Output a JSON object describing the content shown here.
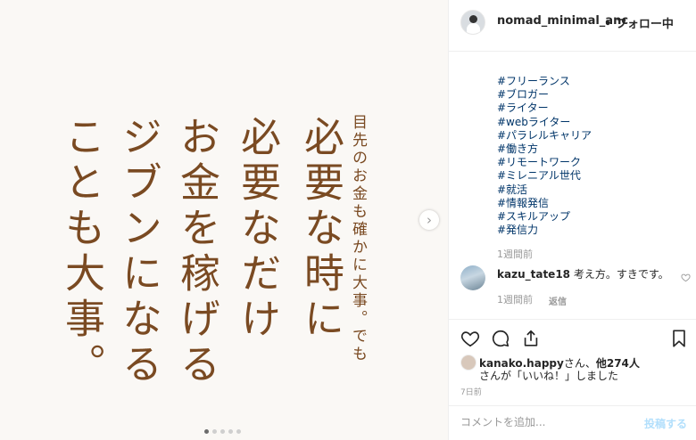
{
  "post": {
    "image_text_columns": [
      "目先のお金も確かに大事。でも",
      "必要な時に",
      "必要なだけ",
      "お金を稼げる",
      "ジブンになる",
      "ことも大事。"
    ]
  },
  "header": {
    "username": "nomad_minimal_anc",
    "follow_label": "• フォロー中"
  },
  "caption": {
    "hashtags": [
      "#フリーランス",
      "#ブロガー",
      "#ライター",
      "#webライター",
      "#パラレルキャリア",
      "#働き方",
      "#リモートワーク",
      "#ミレニアル世代",
      "#就活",
      "#情報発信",
      "#スキルアップ",
      "#発信力"
    ],
    "time": "1週間前"
  },
  "comment": {
    "user": "kazu_tate18",
    "text": " 考え方。すきです。",
    "time": "1週間前",
    "reply_label": "返信"
  },
  "likes": {
    "user": "kanako.happy",
    "line1_suffix": "さん、",
    "others": "他274人",
    "line2": "さんが「いいね！」しました",
    "days_ago": "7日前"
  },
  "comment_box": {
    "placeholder": "コメントを追加...",
    "post_label": "投稿する"
  },
  "colors": {
    "hashtag": "#003569",
    "image_text": "#7a4a22",
    "post_button_disabled": "#b2dffc"
  },
  "icons": [
    "heart-icon",
    "comment-icon",
    "share-icon",
    "bookmark-icon",
    "chevron-right-icon"
  ]
}
